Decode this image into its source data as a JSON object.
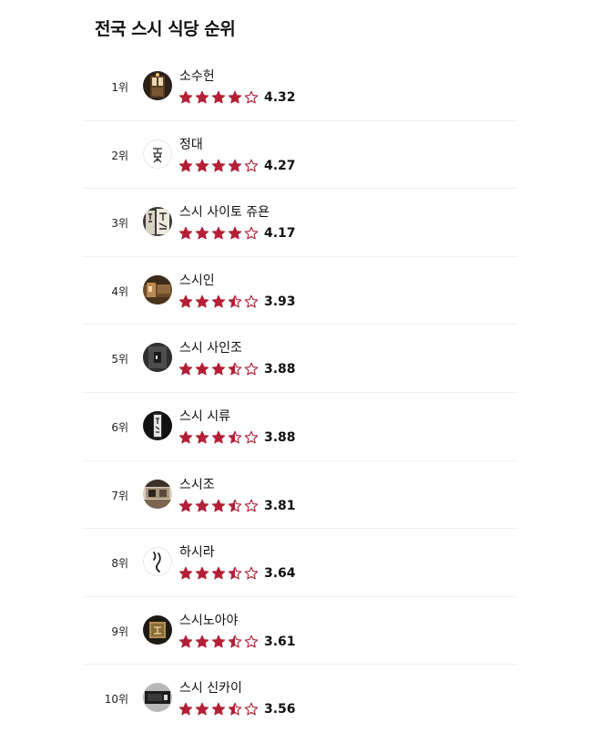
{
  "title": "전국 스시 식당 순위",
  "colors": {
    "star": "#b32036"
  },
  "restaurants": [
    {
      "rank": "1위",
      "name": "소수헌",
      "score": "4.32",
      "stars": 4.0,
      "thumb": "wooden-door-photo"
    },
    {
      "rank": "2위",
      "name": "정대",
      "score": "4.27",
      "stars": 4.0,
      "thumb": "calligraphy-logo"
    },
    {
      "rank": "3위",
      "name": "스시 사이토 쥬욘",
      "score": "4.17",
      "stars": 4.0,
      "thumb": "calligraphy-scroll-photo"
    },
    {
      "rank": "4위",
      "name": "스시인",
      "score": "3.93",
      "stars": 3.5,
      "thumb": "wooden-interior-photo"
    },
    {
      "rank": "5위",
      "name": "스시 사인조",
      "score": "3.88",
      "stars": 3.5,
      "thumb": "dark-interior-photo"
    },
    {
      "rank": "6위",
      "name": "스시 시류",
      "score": "3.88",
      "stars": 3.5,
      "thumb": "dark-scroll-photo"
    },
    {
      "rank": "7위",
      "name": "스시조",
      "score": "3.81",
      "stars": 3.5,
      "thumb": "counter-interior-photo"
    },
    {
      "rank": "8위",
      "name": "하시라",
      "score": "3.64",
      "stars": 3.5,
      "thumb": "brush-stroke-logo"
    },
    {
      "rank": "9위",
      "name": "스시노아야",
      "score": "3.61",
      "stars": 3.5,
      "thumb": "gold-sign-photo"
    },
    {
      "rank": "10위",
      "name": "스시 신카이",
      "score": "3.56",
      "stars": 3.5,
      "thumb": "dark-sign-photo"
    }
  ]
}
